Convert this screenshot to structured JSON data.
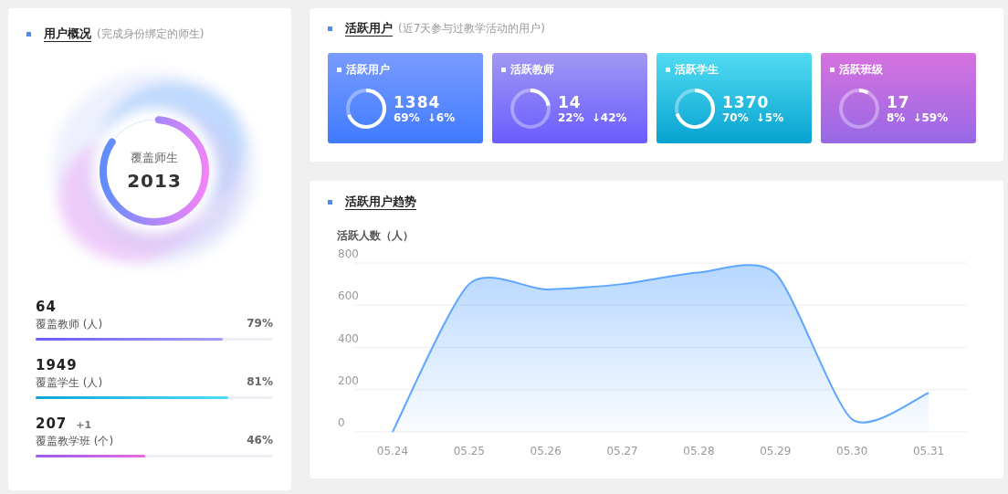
{
  "overview": {
    "title": "用户概况",
    "subtitle": "(完成身份绑定的师生)",
    "ring": {
      "label": "覆盖师生",
      "value": "2013",
      "level": 0.83
    },
    "metrics": [
      {
        "value": "64",
        "label": "覆盖教师 (人)",
        "percent": "79%",
        "level": 0.79,
        "kind": "teacher"
      },
      {
        "value": "1949",
        "label": "覆盖学生 (人)",
        "percent": "81%",
        "level": 0.81,
        "kind": "student"
      },
      {
        "value": "207",
        "extra": "+1",
        "label": "覆盖教学班 (个)",
        "percent": "46%",
        "level": 0.46,
        "kind": "class"
      }
    ]
  },
  "active": {
    "title": "活跃用户",
    "subtitle": "(近7天参与过教学活动的用户)",
    "cards": [
      {
        "title": "活跃用户",
        "value": "1384",
        "percent": "69%",
        "change": "↓6%",
        "level": 0.69,
        "kind": "users"
      },
      {
        "title": "活跃教师",
        "value": "14",
        "percent": "22%",
        "change": "↓42%",
        "level": 0.22,
        "kind": "teachers"
      },
      {
        "title": "活跃学生",
        "value": "1370",
        "percent": "70%",
        "change": "↓5%",
        "level": 0.7,
        "kind": "students"
      },
      {
        "title": "活跃班级",
        "value": "17",
        "percent": "8%",
        "change": "↓59%",
        "level": 0.08,
        "kind": "classes"
      }
    ]
  },
  "trend": {
    "title": "活跃用户趋势",
    "chart_data": {
      "type": "area",
      "ylabel": "活跃人数（人）",
      "categories": [
        "05.24",
        "05.25",
        "05.26",
        "05.27",
        "05.28",
        "05.29",
        "05.30",
        "05.31"
      ],
      "series": [
        {
          "color": "#5ea6ff",
          "values": [
            0,
            700,
            675,
            700,
            755,
            750,
            60,
            185
          ]
        }
      ],
      "ylim": [
        0,
        800
      ],
      "grid": true,
      "yticks": [
        0,
        200,
        400,
        600,
        800
      ]
    }
  }
}
